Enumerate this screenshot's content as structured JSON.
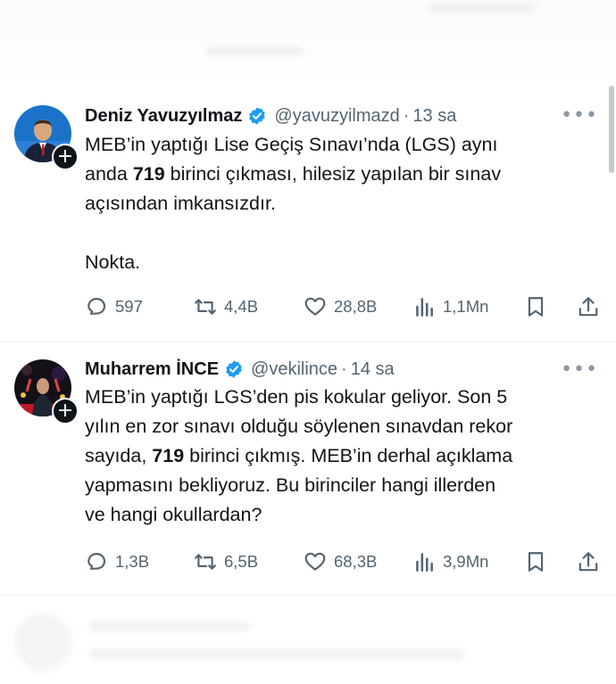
{
  "tweets": [
    {
      "name": "Deniz Yavuzyılmaz",
      "handle": "@yavuzyilmazd",
      "dot": "·",
      "time": "13 sa",
      "text_parts": [
        "MEB’in yaptığı Lise Geçiş Sınavı’nda (LGS) aynı\nanda ",
        "719",
        " birinci çıkması, hilesiz yapılan bir sınav\naçısından imkansızdır.\n\nNokta."
      ],
      "replies": "597",
      "reposts": "4,4B",
      "likes": "28,8B",
      "views": "1,1Mn"
    },
    {
      "name": "Muharrem İNCE",
      "handle": "@vekilince",
      "dot": "·",
      "time": "14 sa",
      "text_parts": [
        "MEB’in yaptığı LGS’den pis kokular geliyor. Son 5\nyılın en zor sınavı olduğu söylenen sınavdan rekor\nsayıda, ",
        "719",
        " birinci çıkmış. MEB’in derhal açıklama\nyapmasını bekliyoruz. Bu birinciler hangi illerden\nve hangi okullardan?"
      ],
      "replies": "1,3B",
      "reposts": "6,5B",
      "likes": "68,3B",
      "views": "3,9Mn"
    }
  ],
  "icons": {
    "verified": "verified-badge-icon",
    "reply": "reply-icon",
    "repost": "repost-icon",
    "like": "heart-icon",
    "views": "views-icon",
    "bookmark": "bookmark-icon",
    "share": "share-icon",
    "more": "more-icon",
    "follow": "plus-icon"
  },
  "more_glyph": "•••",
  "plus_glyph": "+",
  "colors": {
    "verified": "#1d9bf0",
    "text": "#0f1419",
    "muted": "#536471"
  }
}
